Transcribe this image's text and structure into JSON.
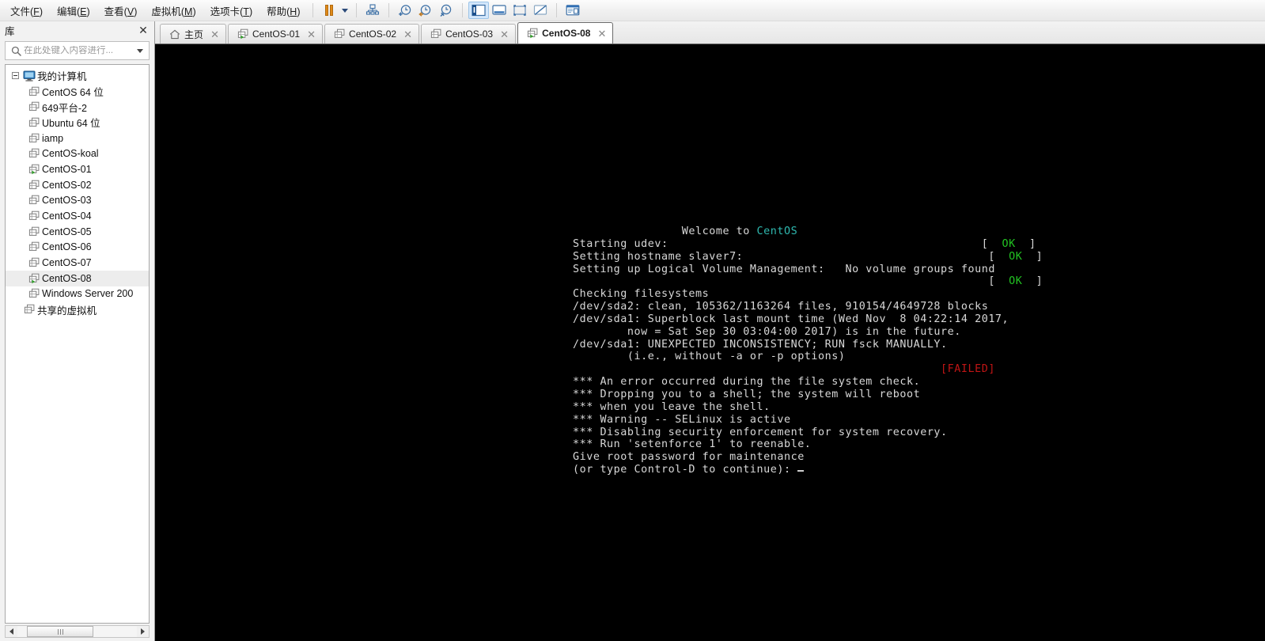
{
  "menu": {
    "items": [
      {
        "label": "文件",
        "mnemonic": "F"
      },
      {
        "label": "编辑",
        "mnemonic": "E"
      },
      {
        "label": "查看",
        "mnemonic": "V"
      },
      {
        "label": "虚拟机",
        "mnemonic": "M"
      },
      {
        "label": "选项卡",
        "mnemonic": "T"
      },
      {
        "label": "帮助",
        "mnemonic": "H"
      }
    ]
  },
  "toolbar": {
    "buttons": [
      {
        "name": "suspend-button",
        "icon": "pause-icon"
      },
      {
        "name": "power-dropdown",
        "icon": "chevron-down-icon"
      },
      {
        "name": "manage-snapshots-button",
        "icon": "snapshot-manager-icon"
      },
      {
        "name": "take-snapshot-button",
        "icon": "snapshot-add-icon"
      },
      {
        "name": "revert-snapshot-button",
        "icon": "snapshot-revert-icon"
      },
      {
        "name": "snapshot-manager-button",
        "icon": "snapshot-settings-icon"
      },
      {
        "name": "show-library-button",
        "icon": "library-panel-icon"
      },
      {
        "name": "console-view-button",
        "icon": "console-view-icon"
      },
      {
        "name": "fullscreen-button",
        "icon": "fullscreen-icon"
      },
      {
        "name": "unity-mode-button",
        "icon": "unity-mode-icon"
      },
      {
        "name": "preferences-button",
        "icon": "preferences-icon"
      }
    ]
  },
  "sidebar": {
    "title": "库",
    "close_label": "✕",
    "search": {
      "placeholder": "在此处键入内容进行...",
      "value": ""
    },
    "tree": [
      {
        "label": "我的计算机",
        "depth": 1,
        "icon": "my-computer-icon",
        "expander": true,
        "running": false,
        "selected": false
      },
      {
        "label": "CentOS 64 位",
        "depth": 2,
        "icon": "vm-icon",
        "running": false,
        "selected": false
      },
      {
        "label": "649平台-2",
        "depth": 2,
        "icon": "vm-icon",
        "running": false,
        "selected": false
      },
      {
        "label": "Ubuntu 64 位",
        "depth": 2,
        "icon": "vm-icon",
        "running": false,
        "selected": false
      },
      {
        "label": "iamp",
        "depth": 2,
        "icon": "vm-icon",
        "running": false,
        "selected": false
      },
      {
        "label": "CentOS-koal",
        "depth": 2,
        "icon": "vm-icon",
        "running": false,
        "selected": false
      },
      {
        "label": "CentOS-01",
        "depth": 2,
        "icon": "vm-icon",
        "running": true,
        "selected": false
      },
      {
        "label": "CentOS-02",
        "depth": 2,
        "icon": "vm-icon",
        "running": false,
        "selected": false
      },
      {
        "label": "CentOS-03",
        "depth": 2,
        "icon": "vm-icon",
        "running": false,
        "selected": false
      },
      {
        "label": "CentOS-04",
        "depth": 2,
        "icon": "vm-icon",
        "running": false,
        "selected": false
      },
      {
        "label": "CentOS-05",
        "depth": 2,
        "icon": "vm-icon",
        "running": false,
        "selected": false
      },
      {
        "label": "CentOS-06",
        "depth": 2,
        "icon": "vm-icon",
        "running": false,
        "selected": false
      },
      {
        "label": "CentOS-07",
        "depth": 2,
        "icon": "vm-icon",
        "running": false,
        "selected": false
      },
      {
        "label": "CentOS-08",
        "depth": 2,
        "icon": "vm-icon",
        "running": true,
        "selected": true
      },
      {
        "label": "Windows Server 200",
        "depth": 2,
        "icon": "vm-icon",
        "running": false,
        "selected": false
      },
      {
        "label": "共享的虚拟机",
        "depth": 1,
        "icon": "shared-vm-icon",
        "expander": false,
        "running": false,
        "selected": false
      }
    ]
  },
  "tabs": [
    {
      "label": "主页",
      "icon": "home-icon",
      "active": false,
      "running": false
    },
    {
      "label": "CentOS-01",
      "icon": "vm-icon",
      "active": false,
      "running": true
    },
    {
      "label": "CentOS-02",
      "icon": "vm-icon",
      "active": false,
      "running": false
    },
    {
      "label": "CentOS-03",
      "icon": "vm-icon",
      "active": false,
      "running": false
    },
    {
      "label": "CentOS-08",
      "icon": "vm-icon",
      "active": true,
      "running": true
    }
  ],
  "console": {
    "background": "#000000",
    "default_color": "#cfcfcf",
    "ok_color": "#22c322",
    "failed_color": "#c01515",
    "brand_color": "#2fb9b0",
    "lines": [
      {
        "segments": [
          {
            "t": "                Welcome to ",
            "c": "white"
          },
          {
            "t": "CentOS",
            "c": "cyan"
          }
        ]
      },
      {
        "segments": [
          {
            "t": "Starting udev:                                              [  ",
            "c": "white"
          },
          {
            "t": "OK",
            "c": "green"
          },
          {
            "t": "  ]",
            "c": "white"
          }
        ]
      },
      {
        "segments": [
          {
            "t": "Setting hostname slaver7:                                    [  ",
            "c": "white"
          },
          {
            "t": "OK",
            "c": "green"
          },
          {
            "t": "  ]",
            "c": "white"
          }
        ]
      },
      {
        "segments": [
          {
            "t": "Setting up Logical Volume Management:   No volume groups found",
            "c": "white"
          }
        ]
      },
      {
        "segments": [
          {
            "t": "                                                             [  ",
            "c": "white"
          },
          {
            "t": "OK",
            "c": "green"
          },
          {
            "t": "  ]",
            "c": "white"
          }
        ]
      },
      {
        "segments": [
          {
            "t": "Checking filesystems",
            "c": "white"
          }
        ]
      },
      {
        "segments": [
          {
            "t": "/dev/sda2: clean, 105362/1163264 files, 910154/4649728 blocks",
            "c": "white"
          }
        ]
      },
      {
        "segments": [
          {
            "t": "/dev/sda1: Superblock last mount time (Wed Nov  8 04:22:14 2017,",
            "c": "white"
          }
        ]
      },
      {
        "segments": [
          {
            "t": "        now = Sat Sep 30 03:04:00 2017) is in the future.",
            "c": "white"
          }
        ]
      },
      {
        "segments": [
          {
            "t": "",
            "c": "white"
          }
        ]
      },
      {
        "segments": [
          {
            "t": "",
            "c": "white"
          }
        ]
      },
      {
        "segments": [
          {
            "t": "/dev/sda1: UNEXPECTED INCONSISTENCY; RUN fsck MANUALLY.",
            "c": "white"
          }
        ]
      },
      {
        "segments": [
          {
            "t": "        (i.e., without -a or -p options)",
            "c": "white"
          }
        ]
      },
      {
        "segments": [
          {
            "t": "                                                      ",
            "c": "white"
          },
          {
            "t": "[FAILED]",
            "c": "red"
          }
        ]
      },
      {
        "segments": [
          {
            "t": "",
            "c": "white"
          }
        ]
      },
      {
        "segments": [
          {
            "t": "*** An error occurred during the file system check.",
            "c": "white"
          }
        ]
      },
      {
        "segments": [
          {
            "t": "*** Dropping you to a shell; the system will reboot",
            "c": "white"
          }
        ]
      },
      {
        "segments": [
          {
            "t": "*** when you leave the shell.",
            "c": "white"
          }
        ]
      },
      {
        "segments": [
          {
            "t": "*** Warning -- SELinux is active",
            "c": "white"
          }
        ]
      },
      {
        "segments": [
          {
            "t": "*** Disabling security enforcement for system recovery.",
            "c": "white"
          }
        ]
      },
      {
        "segments": [
          {
            "t": "*** Run 'setenforce 1' to reenable.",
            "c": "white"
          }
        ]
      },
      {
        "segments": [
          {
            "t": "Give root password for maintenance",
            "c": "white"
          }
        ]
      },
      {
        "segments": [
          {
            "t": "(or type Control-D to continue): ",
            "c": "white"
          }
        ],
        "cursor": true
      }
    ]
  }
}
